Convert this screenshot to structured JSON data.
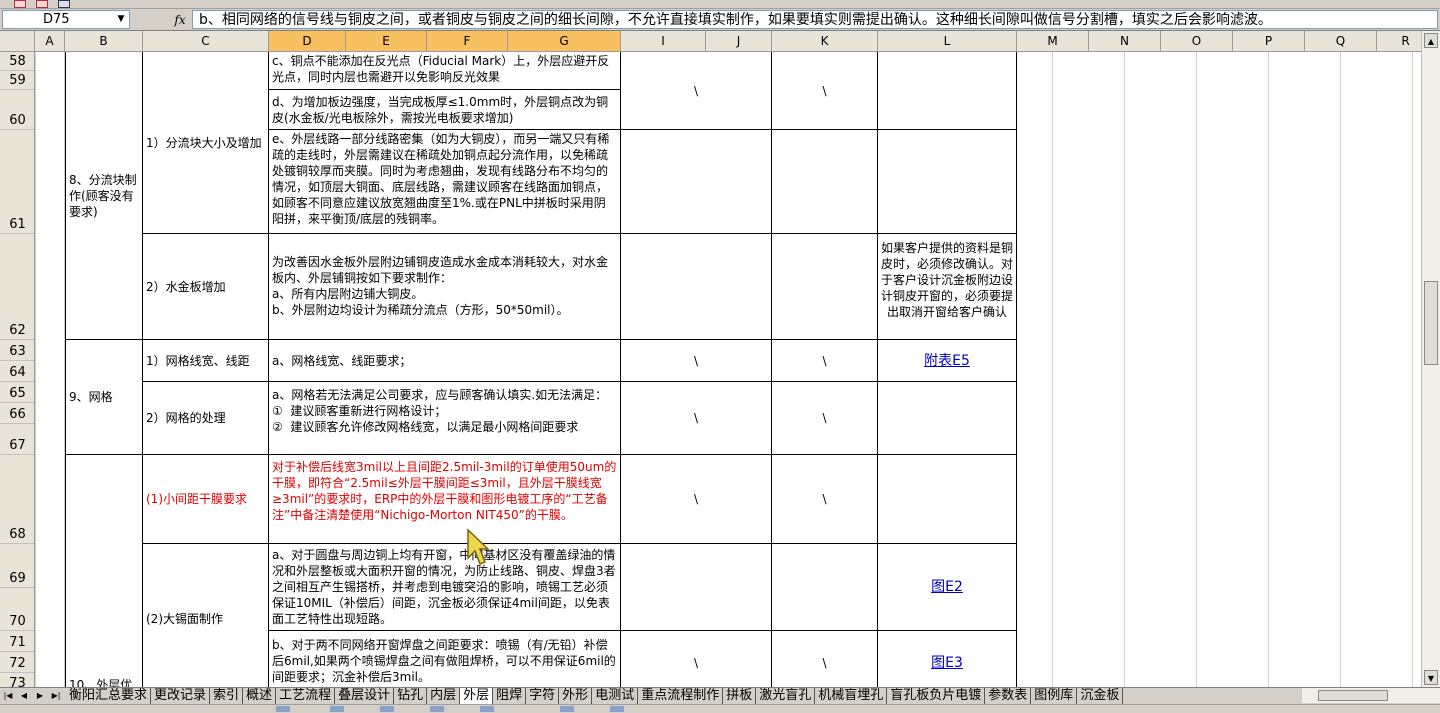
{
  "name_box": "D75",
  "fx_label": "fx",
  "formula_text": "b、相同网络的信号线与铜皮之间，或者铜皮与铜皮之间的细长间隙，不允许直接填实制作，如果要填实则需提出确认。这种细长间隙叫做信号分割槽，填实之后会影响滤波。",
  "columns": [
    "A",
    "B",
    "C",
    "D",
    "E",
    "F",
    "G",
    "I",
    "J",
    "K",
    "L",
    "M",
    "N",
    "O",
    "P",
    "Q",
    "R"
  ],
  "rows": [
    "58",
    "59",
    "60",
    "61",
    "62",
    "63",
    "64",
    "65",
    "66",
    "67",
    "68",
    "69",
    "70",
    "71",
    "72",
    "73"
  ],
  "cells": {
    "b_8": "8、分流块制作(顾客没有要求)",
    "c_8_1": "1）分流块大小及增加",
    "d_58": "c、铜点不能添加在反光点（Fiducial Mark）上，外层应避开反光点，同时内层也需避开以免影响反光效果",
    "d_60": "d、为增加板边强度，当完成板厚≤1.0mm时，外层铜点改为铜皮(水金板/光电板除外，需按光电板要求增加)",
    "d_61": "e、外层线路一部分线路密集（如为大铜皮），而另一端又只有稀疏的走线时，外层需建议在稀疏处加铜点起分流作用，以免稀疏处镀铜较厚而夹膜。同时为考虑翘曲，发现有线路分布不均匀的情况，如顶层大铜面、底层线路，需建议顾客在线路面加铜点，如顾客不同意应建议放宽翘曲度至1%.或在PNL中拼板时采用阴阳拼，来平衡顶/底层的残铜率。",
    "c_62": "2）水金板增加",
    "d_62": "为改善因水金板外层附边铺铜皮造成水金成本消耗较大，对水金板内、外层铺铜按如下要求制作：\na、所有内层附边铺大铜皮。\nb、外层附边均设计为稀疏分流点（方形，50*50mil）。",
    "l_62": "如果客户提供的资料是铜皮时，必须修改确认。对于客户设计沉金板附边设计铜皮开窗的，必须要提出取消开窗给客户确认",
    "b_9": "9、网格",
    "c_63": "1）网格线宽、线距",
    "d_63": "a、网格线宽、线距要求；",
    "l_63": "附表E5",
    "c_66": "2）网格的处理",
    "d_66": "a、网格若无法满足公司要求，应与顾客确认填实.如无法满足：\n①  建议顾客重新进行网格设计；\n②  建议顾客允许修改网格线宽，以满足最小网格间距要求",
    "c_68": "(1)小间距干膜要求",
    "d_68": "对于补偿后线宽3mil以上且间距2.5mil-3mil的订单使用50um的干膜，即符合“2.5mil≤外层干膜间距≤3mil，且外层干膜线宽≥3mil”的要求时，ERP中的外层干膜和图形电镀工序的“工艺备注”中备注清楚使用“Nichigo-Morton NIT450”的干膜。",
    "c_69": "(2)大锡面制作",
    "d_69": "a、对于圆盘与周边铜上均有开窗，中间基材区没有覆盖绿油的情况和外层整板或大面积开窗的情况，为防止线路、铜皮、焊盘3者之间相互产生锡搭桥，并考虑到电镀突沿的影响，喷锡工艺必须保证10MIL（补偿后）间距，沉金板必须保证4mil间距，以免表面工艺特性出现短路。",
    "l_69": "图E2",
    "d_71": "b、对于两不同网络开窗焊盘之间距要求：喷锡（有/无铅）补偿后6mil,如果两个喷锡焊盘之间有做阻焊桥，可以不用保证6mil的间距要求；沉金补偿后3mil。",
    "l_71": "图E3",
    "b_10": "10、外层优",
    "backslash": "\\"
  },
  "sheet_tabs": [
    "衡阳汇总要求",
    "更改记录",
    "索引",
    "概述",
    "工艺流程",
    "叠层设计",
    "钻孔",
    "内层",
    "外层",
    "阻焊",
    "字符",
    "外形",
    "电测试",
    "重点流程制作",
    "拼板",
    "激光盲孔",
    "机械盲埋孔",
    "盲孔板负片电镀",
    "参数表",
    "图例库",
    "沉金板"
  ],
  "active_tab": "外层",
  "colors": {
    "selected_header": "#f8c060",
    "red_text": "#e00000",
    "link": "#0000cc"
  }
}
